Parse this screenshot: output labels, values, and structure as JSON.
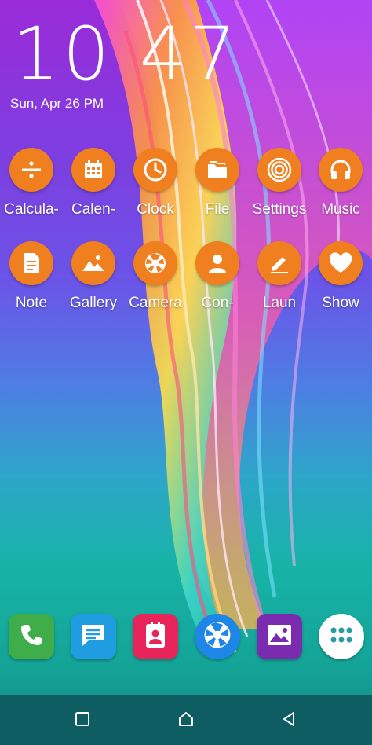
{
  "status": {
    "time": "10 47",
    "date": "Sun, Apr 26 PM"
  },
  "apps_row1": [
    {
      "label": "Calcula-",
      "icon": "calculator-icon"
    },
    {
      "label": "Calen-",
      "icon": "calendar-icon"
    },
    {
      "label": "Clock",
      "icon": "clock-icon"
    },
    {
      "label": "File",
      "icon": "folder-icon"
    },
    {
      "label": "Settings",
      "icon": "settings-icon"
    },
    {
      "label": "Music",
      "icon": "headphones-icon"
    }
  ],
  "apps_row2": [
    {
      "label": "Note",
      "icon": "note-icon"
    },
    {
      "label": "Gallery",
      "icon": "gallery-icon"
    },
    {
      "label": "Camera",
      "icon": "camera-aperture-icon"
    },
    {
      "label": "Con-",
      "icon": "contacts-icon"
    },
    {
      "label": "Laun",
      "icon": "pencil-icon"
    },
    {
      "label": "Show",
      "icon": "heart-icon"
    }
  ],
  "dock": [
    {
      "name": "phone",
      "icon": "phone-icon",
      "color": "#3fae4a"
    },
    {
      "name": "messages",
      "icon": "message-icon",
      "color": "#1f9de0"
    },
    {
      "name": "contacts",
      "icon": "contact-card-icon",
      "color": "#e8255a"
    },
    {
      "name": "camera",
      "icon": "camera-aperture-icon",
      "color": "#1e86e6"
    },
    {
      "name": "gallery",
      "icon": "gallery-icon",
      "color": "#7a2bb0"
    },
    {
      "name": "app-drawer",
      "icon": "app-drawer-icon",
      "color": "#ffffff"
    }
  ],
  "navigation": {
    "buttons": [
      "recents-icon",
      "home-icon",
      "back-icon"
    ]
  },
  "theme": {
    "icon_bubble": "#f07f1f",
    "navbar": "#0d5d63"
  }
}
